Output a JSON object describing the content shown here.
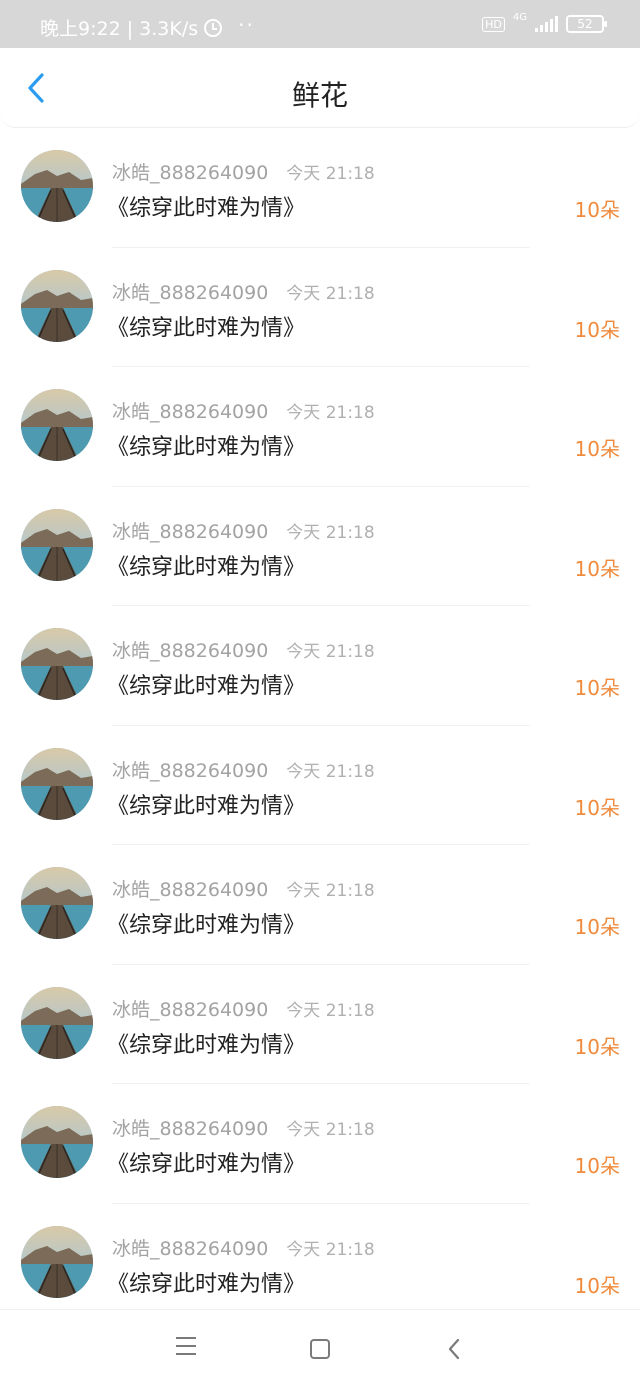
{
  "status_bar": {
    "time_speed": "晚上9:22 | 3.3K/s",
    "hd": "HD",
    "network": "4G",
    "battery": "52",
    "more": "··"
  },
  "header": {
    "title": "鲜花",
    "back_icon": "chevron-left-icon",
    "accent_color": "#2b9cf0"
  },
  "list": {
    "items": [
      {
        "username": "冰皓_888264090",
        "time": "今天 21:18",
        "book": "《综穿此时难为情》",
        "amount": "10朵"
      },
      {
        "username": "冰皓_888264090",
        "time": "今天 21:18",
        "book": "《综穿此时难为情》",
        "amount": "10朵"
      },
      {
        "username": "冰皓_888264090",
        "time": "今天 21:18",
        "book": "《综穿此时难为情》",
        "amount": "10朵"
      },
      {
        "username": "冰皓_888264090",
        "time": "今天 21:18",
        "book": "《综穿此时难为情》",
        "amount": "10朵"
      },
      {
        "username": "冰皓_888264090",
        "time": "今天 21:18",
        "book": "《综穿此时难为情》",
        "amount": "10朵"
      },
      {
        "username": "冰皓_888264090",
        "time": "今天 21:18",
        "book": "《综穿此时难为情》",
        "amount": "10朵"
      },
      {
        "username": "冰皓_888264090",
        "time": "今天 21:18",
        "book": "《综穿此时难为情》",
        "amount": "10朵"
      },
      {
        "username": "冰皓_888264090",
        "time": "今天 21:18",
        "book": "《综穿此时难为情》",
        "amount": "10朵"
      },
      {
        "username": "冰皓_888264090",
        "time": "今天 21:18",
        "book": "《综穿此时难为情》",
        "amount": "10朵"
      },
      {
        "username": "冰皓_888264090",
        "time": "今天 21:18",
        "book": "《综穿此时难为情》",
        "amount": "10朵"
      }
    ],
    "amount_color": "#f08a3c"
  },
  "nav_bar": {
    "icons": [
      "menu-icon",
      "home-icon",
      "back-icon"
    ]
  }
}
